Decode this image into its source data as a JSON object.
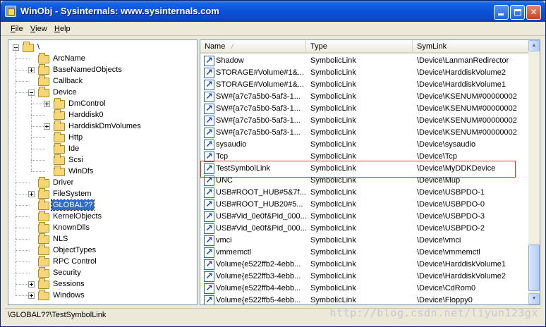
{
  "window": {
    "title": "WinObj - Sysinternals: www.sysinternals.com",
    "minimize_icon": "minimize-icon",
    "maximize_icon": "maximize-icon",
    "close_icon": "close-icon"
  },
  "menu": {
    "file": {
      "first": "F",
      "rest": "ile"
    },
    "view": {
      "first": "V",
      "rest": "iew"
    },
    "help": {
      "first": "H",
      "rest": "elp"
    }
  },
  "tree": {
    "items": [
      {
        "label": "\\",
        "depth": 0,
        "expander": "minus"
      },
      {
        "label": "ArcName",
        "depth": 1,
        "expander": "none"
      },
      {
        "label": "BaseNamedObjects",
        "depth": 1,
        "expander": "plus"
      },
      {
        "label": "Callback",
        "depth": 1,
        "expander": "none"
      },
      {
        "label": "Device",
        "depth": 1,
        "expander": "minus"
      },
      {
        "label": "DmControl",
        "depth": 2,
        "expander": "plus"
      },
      {
        "label": "Harddisk0",
        "depth": 2,
        "expander": "none"
      },
      {
        "label": "HarddiskDmVolumes",
        "depth": 2,
        "expander": "plus"
      },
      {
        "label": "Http",
        "depth": 2,
        "expander": "none"
      },
      {
        "label": "Ide",
        "depth": 2,
        "expander": "none"
      },
      {
        "label": "Scsi",
        "depth": 2,
        "expander": "none"
      },
      {
        "label": "WinDfs",
        "depth": 2,
        "expander": "none"
      },
      {
        "label": "Driver",
        "depth": 1,
        "expander": "none"
      },
      {
        "label": "FileSystem",
        "depth": 1,
        "expander": "plus"
      },
      {
        "label": "GLOBAL??",
        "depth": 1,
        "expander": "none",
        "selected": true
      },
      {
        "label": "KernelObjects",
        "depth": 1,
        "expander": "none"
      },
      {
        "label": "KnownDlls",
        "depth": 1,
        "expander": "none"
      },
      {
        "label": "NLS",
        "depth": 1,
        "expander": "none"
      },
      {
        "label": "ObjectTypes",
        "depth": 1,
        "expander": "none"
      },
      {
        "label": "RPC Control",
        "depth": 1,
        "expander": "none"
      },
      {
        "label": "Security",
        "depth": 1,
        "expander": "none"
      },
      {
        "label": "Sessions",
        "depth": 1,
        "expander": "plus"
      },
      {
        "label": "Windows",
        "depth": 1,
        "expander": "plus"
      }
    ]
  },
  "list": {
    "columns": {
      "name": "Name",
      "type": "Type",
      "symlink": "SymLink"
    },
    "rows": [
      {
        "name": "Shadow",
        "type": "SymbolicLink",
        "symlink": "\\Device\\LanmanRedirector"
      },
      {
        "name": "STORAGE#Volume#1&...",
        "type": "SymbolicLink",
        "symlink": "\\Device\\HarddiskVolume2"
      },
      {
        "name": "STORAGE#Volume#1&...",
        "type": "SymbolicLink",
        "symlink": "\\Device\\HarddiskVolume1"
      },
      {
        "name": "SW#{a7c7a5b0-5af3-1...",
        "type": "SymbolicLink",
        "symlink": "\\Device\\KSENUM#00000002"
      },
      {
        "name": "SW#{a7c7a5b0-5af3-1...",
        "type": "SymbolicLink",
        "symlink": "\\Device\\KSENUM#00000002"
      },
      {
        "name": "SW#{a7c7a5b0-5af3-1...",
        "type": "SymbolicLink",
        "symlink": "\\Device\\KSENUM#00000002"
      },
      {
        "name": "SW#{a7c7a5b0-5af3-1...",
        "type": "SymbolicLink",
        "symlink": "\\Device\\KSENUM#00000002"
      },
      {
        "name": "sysaudio",
        "type": "SymbolicLink",
        "symlink": "\\Device\\sysaudio"
      },
      {
        "name": "Tcp",
        "type": "SymbolicLink",
        "symlink": "\\Device\\Tcp"
      },
      {
        "name": "TestSymbolLink",
        "type": "SymbolicLink",
        "symlink": "\\Device\\MyDDKDevice"
      },
      {
        "name": "UNC",
        "type": "SymbolicLink",
        "symlink": "\\Device\\Mup"
      },
      {
        "name": "USB#ROOT_HUB#5&7f...",
        "type": "SymbolicLink",
        "symlink": "\\Device\\USBPDO-1"
      },
      {
        "name": "USB#ROOT_HUB20#5...",
        "type": "SymbolicLink",
        "symlink": "\\Device\\USBPDO-0"
      },
      {
        "name": "USB#Vid_0e0f&Pid_000...",
        "type": "SymbolicLink",
        "symlink": "\\Device\\USBPDO-3"
      },
      {
        "name": "USB#Vid_0e0f&Pid_000...",
        "type": "SymbolicLink",
        "symlink": "\\Device\\USBPDO-2"
      },
      {
        "name": "vmci",
        "type": "SymbolicLink",
        "symlink": "\\Device\\vmci"
      },
      {
        "name": "vmmemctl",
        "type": "SymbolicLink",
        "symlink": "\\Device\\vmmemctl"
      },
      {
        "name": "Volume{e522ffb2-4ebb...",
        "type": "SymbolicLink",
        "symlink": "\\Device\\HarddiskVolume1"
      },
      {
        "name": "Volume{e522ffb3-4ebb...",
        "type": "SymbolicLink",
        "symlink": "\\Device\\HarddiskVolume2"
      },
      {
        "name": "Volume{e522ffb4-4ebb...",
        "type": "SymbolicLink",
        "symlink": "\\Device\\CdRom0"
      },
      {
        "name": "Volume{e522ffb5-4ebb...",
        "type": "SymbolicLink",
        "symlink": "\\Device\\Floppy0"
      }
    ]
  },
  "status": {
    "path": "\\GLOBAL??\\TestSymbolLink"
  },
  "watermark": "http://blog.csdn.net/liyun123gx",
  "colors": {
    "selection": "#316ac5",
    "highlight_border": "#e03030",
    "titlebar": "#0a52d9"
  }
}
